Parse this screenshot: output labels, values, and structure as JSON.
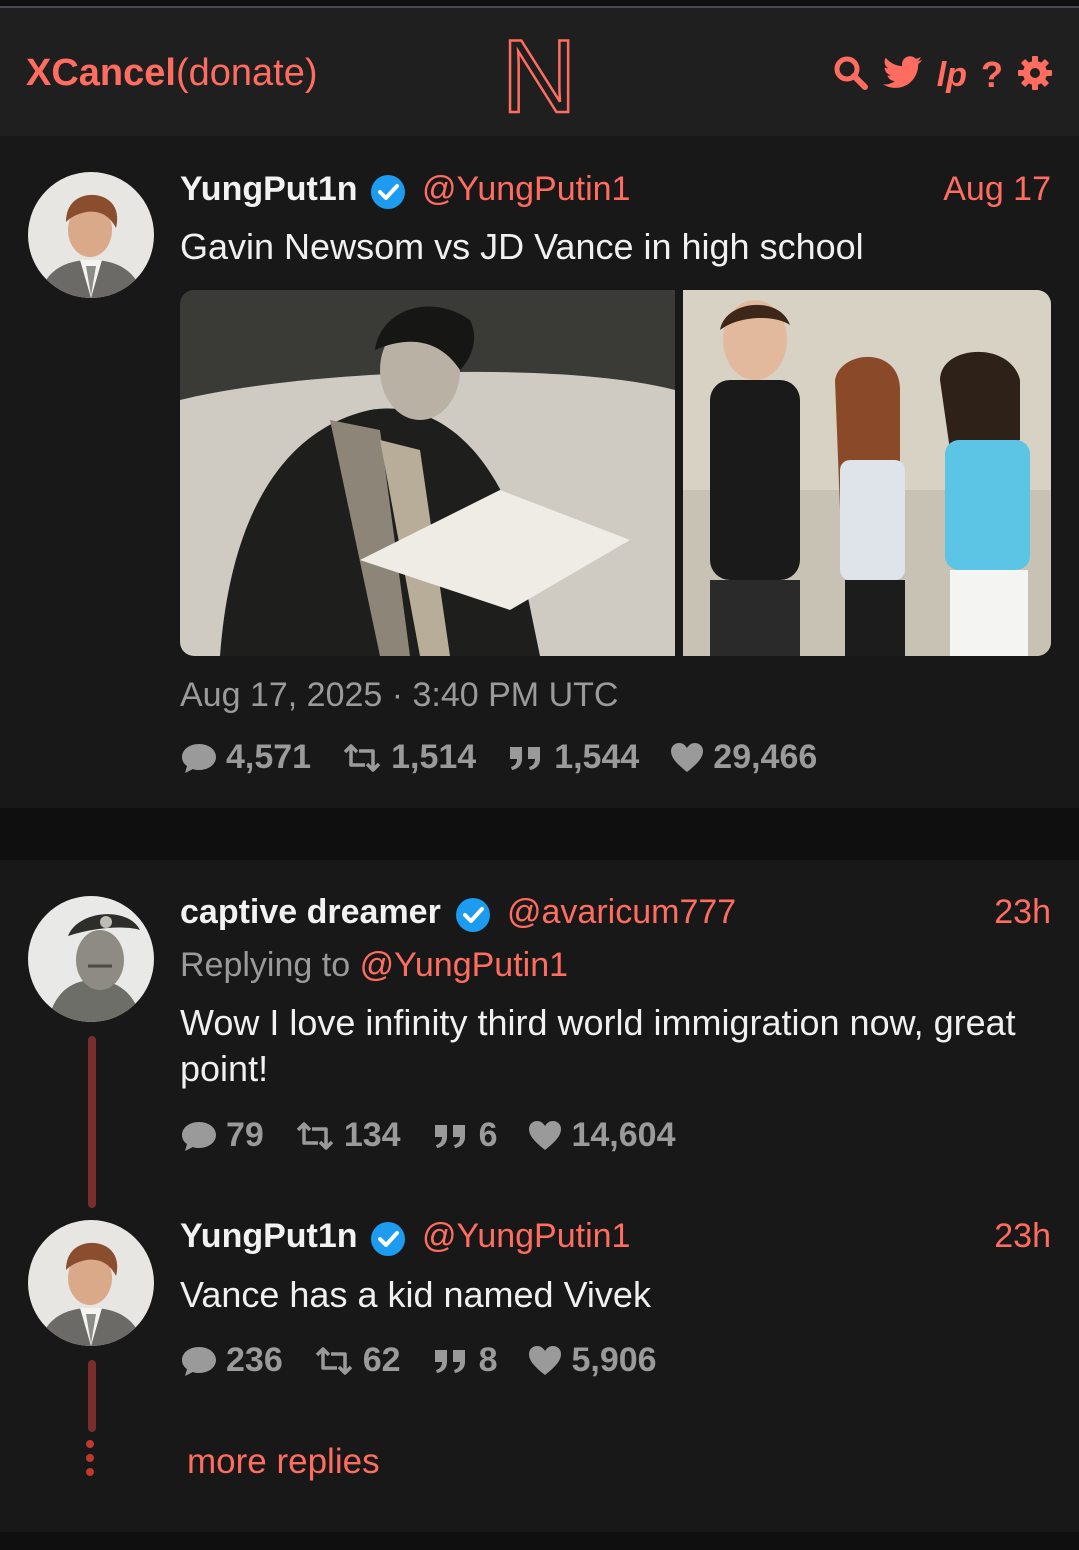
{
  "nav": {
    "brand": "XCancel",
    "donate": "(donate)",
    "logo_letter": "N",
    "icons": [
      "search-icon",
      "twitter-bird-icon",
      "lp-icon",
      "help-icon",
      "settings-gear-icon"
    ],
    "help_label": "?",
    "lp_label": "lp"
  },
  "colors": {
    "accent": "#ff6c60",
    "background": "#181818",
    "navbar": "#1f1f1f",
    "muted": "#9a9a9a",
    "verified": "#1d9bf0",
    "thread": "#7a2e2b"
  },
  "main_tweet": {
    "display_name": "YungPut1n",
    "handle": "@YungPutin1",
    "date": "Aug 17",
    "text": "Gavin Newsom vs JD Vance in high school",
    "timestamp": "Aug 17, 2025 · 3:40 PM UTC",
    "stats": {
      "replies": "4,571",
      "retweets": "1,514",
      "quotes": "1,544",
      "likes": "29,466"
    }
  },
  "replies": [
    {
      "display_name": "captive dreamer",
      "handle": "@avaricum777",
      "date": "23h",
      "replying_prefix": "Replying to",
      "replying_to": "@YungPutin1",
      "text": "Wow I love infinity third world immigration now, great point!",
      "stats": {
        "replies": "79",
        "retweets": "134",
        "quotes": "6",
        "likes": "14,604"
      }
    },
    {
      "display_name": "YungPut1n",
      "handle": "@YungPutin1",
      "date": "23h",
      "text": "Vance has a kid named Vivek",
      "stats": {
        "replies": "236",
        "retweets": "62",
        "quotes": "8",
        "likes": "5,906"
      }
    }
  ],
  "more_replies": "more replies"
}
